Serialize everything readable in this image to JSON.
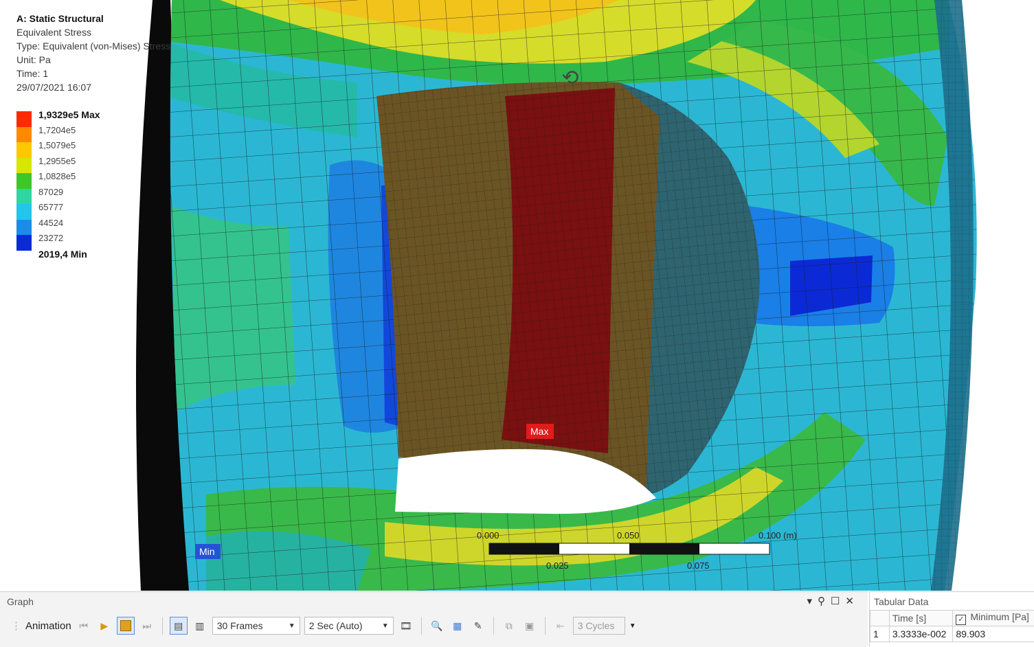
{
  "legend": {
    "title": "A: Static Structural",
    "result": "Equivalent Stress",
    "type": "Type: Equivalent (von-Mises) Stress",
    "unit": "Unit: Pa",
    "time": "Time: 1",
    "date": "29/07/2021 16:07",
    "labels": [
      "1,9329e5 Max",
      "1,7204e5",
      "1,5079e5",
      "1,2955e5",
      "1,0828e5",
      "87029",
      "65777",
      "44524",
      "23272",
      "2019,4 Min"
    ],
    "colors": [
      "#ff0000",
      "#ff6a00",
      "#ffb000",
      "#ffe600",
      "#b8e000",
      "#3ec72d",
      "#2fd2a0",
      "#29c3e6",
      "#1f8fe8",
      "#0a2ad8"
    ]
  },
  "probes": {
    "max": "Max",
    "min": "Min"
  },
  "scale_bar": {
    "top_labels": [
      "0.000",
      "0.050",
      "0.100 (m)"
    ],
    "bottom_labels": [
      "0.025",
      "0.075"
    ]
  },
  "graph_panel": {
    "title": "Graph",
    "animation_label": "Animation",
    "frames": "30 Frames",
    "duration": "2 Sec (Auto)",
    "cycles": "3 Cycles"
  },
  "tabular_panel": {
    "title": "Tabular Data",
    "columns": [
      "Time [s]",
      "Minimum [Pa]"
    ],
    "rows": [
      {
        "index": "1",
        "time": "3.3333e-002",
        "minimum": "89.903"
      }
    ]
  },
  "colors": {
    "max_probe": "#e21b1b",
    "min_probe": "#2553d6"
  }
}
